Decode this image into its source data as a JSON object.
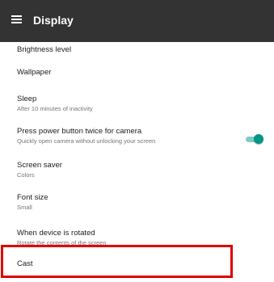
{
  "header": {
    "title": "Display",
    "menu_icon": "menu-icon"
  },
  "settings": [
    {
      "title": "Brightness level",
      "subtitle": ""
    },
    {
      "title": "Wallpaper",
      "subtitle": ""
    },
    {
      "title": "Sleep",
      "subtitle": "After 10 minutes of inactivity"
    },
    {
      "title": "Press power button twice for camera",
      "subtitle": "Quickly open camera without unlocking your screen",
      "toggle": "on"
    },
    {
      "title": "Screen saver",
      "subtitle": "Colors"
    },
    {
      "title": "Font size",
      "subtitle": "Small"
    },
    {
      "title": "When device is rotated",
      "subtitle": "Rotate the contents of the screen"
    },
    {
      "title": "Cast",
      "subtitle": ""
    }
  ],
  "colors": {
    "appbar": "#333333",
    "accent": "#009688",
    "highlight": "#e00000"
  }
}
